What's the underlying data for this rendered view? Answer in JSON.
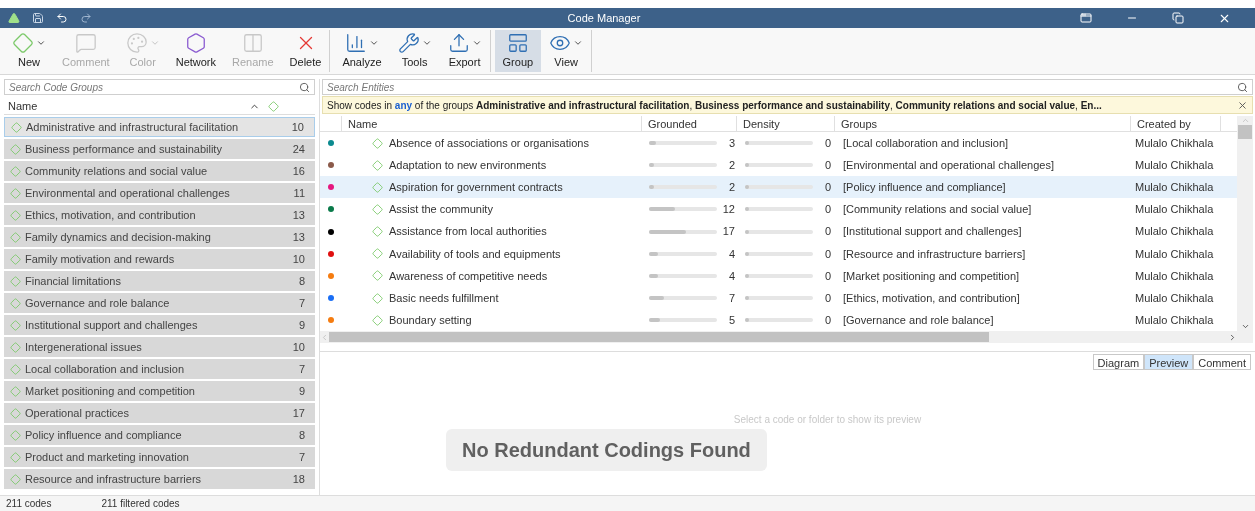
{
  "window": {
    "title": "Code Manager"
  },
  "ribbon": [
    {
      "label": "New",
      "kind": "new",
      "disabled": false,
      "dropdown": true,
      "selected": false
    },
    {
      "label": "Comment",
      "kind": "comment",
      "disabled": true,
      "dropdown": false,
      "selected": false
    },
    {
      "label": "Color",
      "kind": "color",
      "disabled": true,
      "dropdown": true,
      "selected": false
    },
    {
      "label": "Network",
      "kind": "network",
      "disabled": false,
      "dropdown": false,
      "selected": false
    },
    {
      "label": "Rename",
      "kind": "rename",
      "disabled": true,
      "dropdown": false,
      "selected": false
    },
    {
      "label": "Delete",
      "kind": "delete",
      "disabled": false,
      "dropdown": false,
      "selected": false,
      "separator_after": true
    },
    {
      "label": "Analyze",
      "kind": "analyze",
      "disabled": false,
      "dropdown": true,
      "selected": false
    },
    {
      "label": "Tools",
      "kind": "tools",
      "disabled": false,
      "dropdown": true,
      "selected": false
    },
    {
      "label": "Export",
      "kind": "export",
      "disabled": false,
      "dropdown": true,
      "selected": false,
      "separator_after": true
    },
    {
      "label": "Group",
      "kind": "group",
      "disabled": false,
      "dropdown": false,
      "selected": true
    },
    {
      "label": "View",
      "kind": "view",
      "disabled": false,
      "dropdown": true,
      "selected": false,
      "separator_after": true
    }
  ],
  "groups_panel": {
    "search": {
      "placeholder": "Search Code Groups"
    },
    "column": "Name",
    "items": [
      {
        "name": "Administrative and infrastructural facilitation",
        "count": "10",
        "selected": true
      },
      {
        "name": "Business performance and sustainability",
        "count": "24",
        "selected": false
      },
      {
        "name": "Community relations and social value",
        "count": "16",
        "selected": false
      },
      {
        "name": "Environmental and operational challenges",
        "count": "11",
        "selected": false
      },
      {
        "name": "Ethics, motivation, and contribution",
        "count": "13",
        "selected": false
      },
      {
        "name": "Family dynamics and decision-making",
        "count": "13",
        "selected": false
      },
      {
        "name": "Family motivation and rewards",
        "count": "10",
        "selected": false
      },
      {
        "name": "Financial limitations",
        "count": "8",
        "selected": false
      },
      {
        "name": "Governance and role balance",
        "count": "7",
        "selected": false
      },
      {
        "name": "Institutional support and challenges",
        "count": "9",
        "selected": false
      },
      {
        "name": "Intergenerational issues",
        "count": "10",
        "selected": false
      },
      {
        "name": "Local collaboration and inclusion",
        "count": "7",
        "selected": false
      },
      {
        "name": "Market positioning and competition",
        "count": "9",
        "selected": false
      },
      {
        "name": "Operational practices",
        "count": "17",
        "selected": false
      },
      {
        "name": "Policy influence and compliance",
        "count": "8",
        "selected": false
      },
      {
        "name": "Product and marketing innovation",
        "count": "7",
        "selected": false
      },
      {
        "name": "Resource and infrastructure barriers",
        "count": "18",
        "selected": false
      }
    ]
  },
  "entities": {
    "search": {
      "placeholder": "Search Entities"
    },
    "filter": {
      "prefix": "Show codes in",
      "mode": "any",
      "middle": "of the groups",
      "groups": "**Administrative and infrastructural facilitation**, **Business performance and sustainability**, **Community relations and social value**, **En...**"
    },
    "columns": [
      "Name",
      "Grounded",
      "Density",
      "Groups",
      "Created by"
    ],
    "rows": [
      {
        "color": "#0b8a8f",
        "name": "Absence of associations or organisations",
        "grounded": {
          "value": "3",
          "level": 0.1
        },
        "density": {
          "value": "0",
          "level": 0
        },
        "groups": "[Local collaboration and inclusion]",
        "created_by": "Mulalo Chikhala",
        "selected": false
      },
      {
        "color": "#8b5a4a",
        "name": "Adaptation to new environments",
        "grounded": {
          "value": "2",
          "level": 0.07
        },
        "density": {
          "value": "0",
          "level": 0
        },
        "groups": "[Environmental and operational challenges]",
        "created_by": "Mulalo Chikhala",
        "selected": false
      },
      {
        "color": "#e5177e",
        "name": "Aspiration for government contracts",
        "grounded": {
          "value": "2",
          "level": 0.07
        },
        "density": {
          "value": "0",
          "level": 0
        },
        "groups": "[Policy influence and compliance]",
        "created_by": "Mulalo Chikhala",
        "selected": true
      },
      {
        "color": "#0a7a4a",
        "name": "Assist the community",
        "grounded": {
          "value": "12",
          "level": 0.38
        },
        "density": {
          "value": "0",
          "level": 0
        },
        "groups": "[Community relations and social value]",
        "created_by": "Mulalo Chikhala",
        "selected": false
      },
      {
        "color": "#000000",
        "name": "Assistance from local authorities",
        "grounded": {
          "value": "17",
          "level": 0.55
        },
        "density": {
          "value": "0",
          "level": 0
        },
        "groups": "[Institutional support and challenges]",
        "created_by": "Mulalo Chikhala",
        "selected": false
      },
      {
        "color": "#e01010",
        "name": "Availability of tools and equipments",
        "grounded": {
          "value": "4",
          "level": 0.13
        },
        "density": {
          "value": "0",
          "level": 0
        },
        "groups": "[Resource and infrastructure barriers]",
        "created_by": "Mulalo Chikhala",
        "selected": false
      },
      {
        "color": "#f57c10",
        "name": "Awareness of competitive needs",
        "grounded": {
          "value": "4",
          "level": 0.13
        },
        "density": {
          "value": "0",
          "level": 0
        },
        "groups": "[Market positioning and competition]",
        "created_by": "Mulalo Chikhala",
        "selected": false
      },
      {
        "color": "#1a6ef5",
        "name": "Basic needs fulfillment",
        "grounded": {
          "value": "7",
          "level": 0.22
        },
        "density": {
          "value": "0",
          "level": 0
        },
        "groups": "[Ethics, motivation, and contribution]",
        "created_by": "Mulalo Chikhala",
        "selected": false
      },
      {
        "color": "#f57c10",
        "name": "Boundary setting",
        "grounded": {
          "value": "5",
          "level": 0.16
        },
        "density": {
          "value": "0",
          "level": 0
        },
        "groups": "[Governance and role balance]",
        "created_by": "Mulalo Chikhala",
        "selected": false
      }
    ]
  },
  "preview_tabs": [
    {
      "label": "Diagram",
      "selected": false
    },
    {
      "label": "Preview",
      "selected": true
    },
    {
      "label": "Comment",
      "selected": false
    }
  ],
  "preview": {
    "hint": "Select a code or folder to show its preview",
    "toast": "No Redundant Codings Found"
  },
  "status_bar": [
    "211 codes",
    "211 filtered codes"
  ]
}
